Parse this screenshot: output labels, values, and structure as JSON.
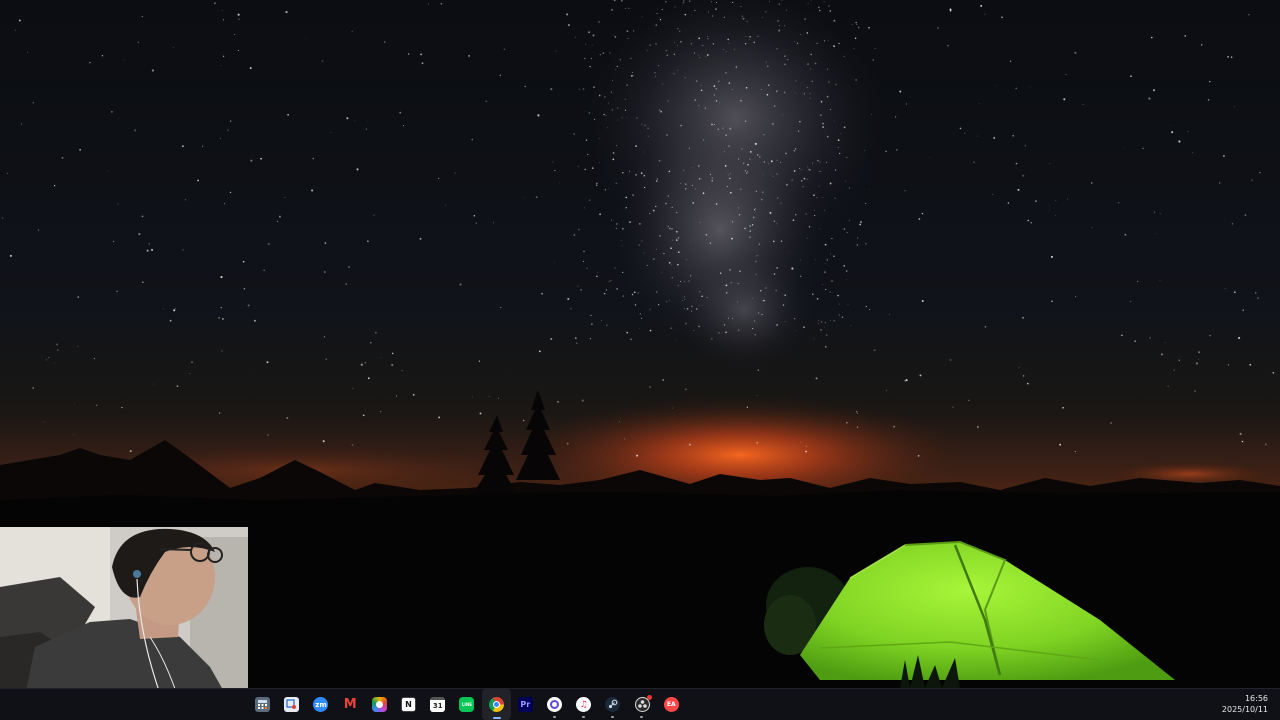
{
  "taskbar": {
    "apps": [
      {
        "name": "calculator-icon"
      },
      {
        "name": "snipping-tool-icon"
      },
      {
        "name": "zoom-icon",
        "glyph": "zm"
      },
      {
        "name": "gmail-icon",
        "glyph": "M"
      },
      {
        "name": "photos-icon"
      },
      {
        "name": "notion-icon",
        "glyph": "N"
      },
      {
        "name": "calendar-icon",
        "glyph": "31"
      },
      {
        "name": "line-icon",
        "glyph": "LINE"
      },
      {
        "name": "chrome-icon"
      },
      {
        "name": "premiere-pro-icon",
        "glyph": "Pr"
      },
      {
        "name": "assistant-app-icon"
      },
      {
        "name": "itunes-icon",
        "glyph": "♫"
      },
      {
        "name": "steam-icon"
      },
      {
        "name": "obs-icon"
      },
      {
        "name": "ea-app-icon",
        "glyph": "EA"
      }
    ],
    "clock": {
      "time": "16:56",
      "date": "2025/10/11"
    }
  },
  "colors": {
    "taskbar_bg": "#0f1116",
    "tent_green": "#8fe32a",
    "horizon_glow": "#e0541c"
  }
}
